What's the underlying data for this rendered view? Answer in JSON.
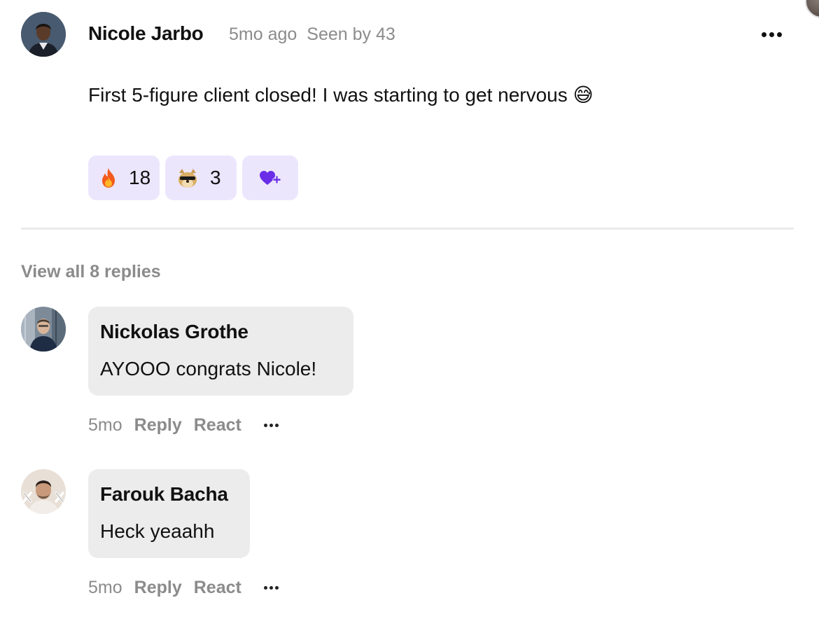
{
  "post": {
    "author": "Nicole Jarbo",
    "time": "5mo ago",
    "seen": "Seen by 43",
    "body": "First 5-figure client closed! I was starting to get nervous 😅",
    "more_icon": "more-horizontal-icon"
  },
  "reactions": [
    {
      "emoji": "🔥",
      "icon": "fire-icon",
      "count": "18"
    },
    {
      "emoji": "doge-sunglasses",
      "icon": "doge-icon",
      "count": "3"
    },
    {
      "icon": "heart-plus-icon",
      "color": "#6a2ee8"
    }
  ],
  "replies_link": "View all 8 replies",
  "replies": [
    {
      "author": "Nickolas Grothe",
      "text": "AYOOO congrats Nicole!",
      "time": "5mo",
      "reply_label": "Reply",
      "react_label": "React"
    },
    {
      "author": "Farouk Bacha",
      "text": "Heck yeaahh",
      "time": "5mo",
      "reply_label": "Reply",
      "react_label": "React"
    }
  ],
  "colors": {
    "reaction_bg": "#ece6fd",
    "bubble_bg": "#ececec",
    "muted_text": "#8b8b8b",
    "accent": "#6a2ee8"
  }
}
